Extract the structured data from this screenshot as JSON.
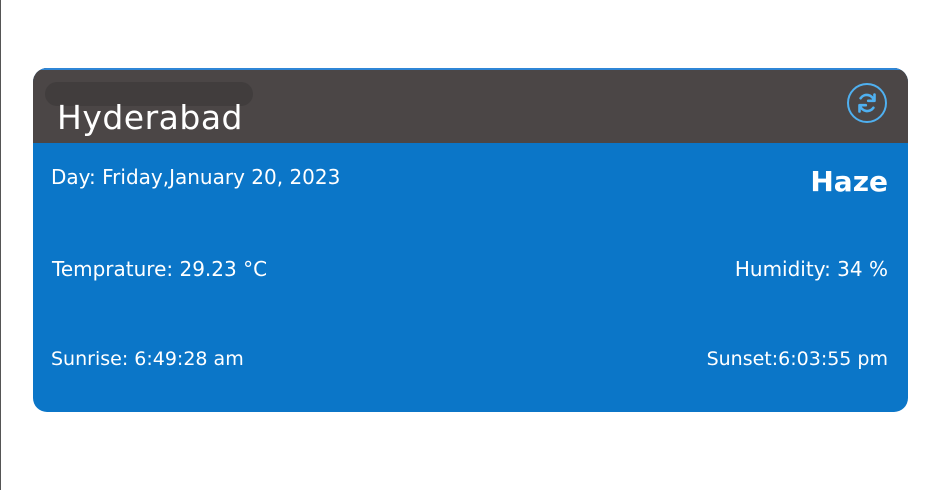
{
  "header": {
    "city": "Hyderabad",
    "refresh_icon": "refresh-icon"
  },
  "weather": {
    "day": "Day: Friday,January 20, 2023",
    "condition": "Haze",
    "temperature": "Temprature: 29.23 °C",
    "humidity": "Humidity: 34 %",
    "sunrise": "Sunrise: 6:49:28 am",
    "sunset": "Sunset:6:03:55 pm"
  },
  "colors": {
    "header_bg": "#4b4646",
    "card_bg": "#0b76c8",
    "accent": "#4fb0f0"
  }
}
